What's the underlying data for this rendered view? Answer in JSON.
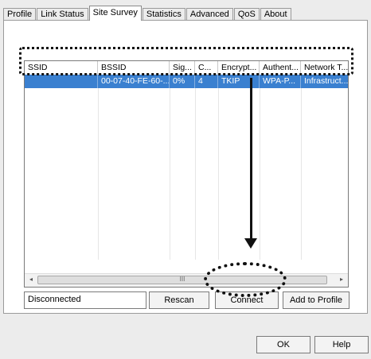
{
  "tabs": [
    "Profile",
    "Link Status",
    "Site Survey",
    "Statistics",
    "Advanced",
    "QoS",
    "About"
  ],
  "active_tab": "Site Survey",
  "table": {
    "columns": [
      "SSID",
      "BSSID",
      "Sig...",
      "C...",
      "Encrypt...",
      "Authent...",
      "Network T..."
    ],
    "rows": [
      {
        "ssid": "",
        "bssid": "00-07-40-FE-60-...",
        "signal": "0%",
        "channel": "4",
        "encryption": "TKIP",
        "authentication": "WPA-P...",
        "network_type": "Infrastruct..."
      }
    ]
  },
  "scrollbar": {
    "left_arrow": "◂",
    "right_arrow": "▸",
    "thumb_grip": "III"
  },
  "status": "Disconnected",
  "buttons": {
    "rescan": "Rescan",
    "connect": "Connect",
    "add_to_profile": "Add to Profile",
    "ok": "OK",
    "help": "Help"
  }
}
